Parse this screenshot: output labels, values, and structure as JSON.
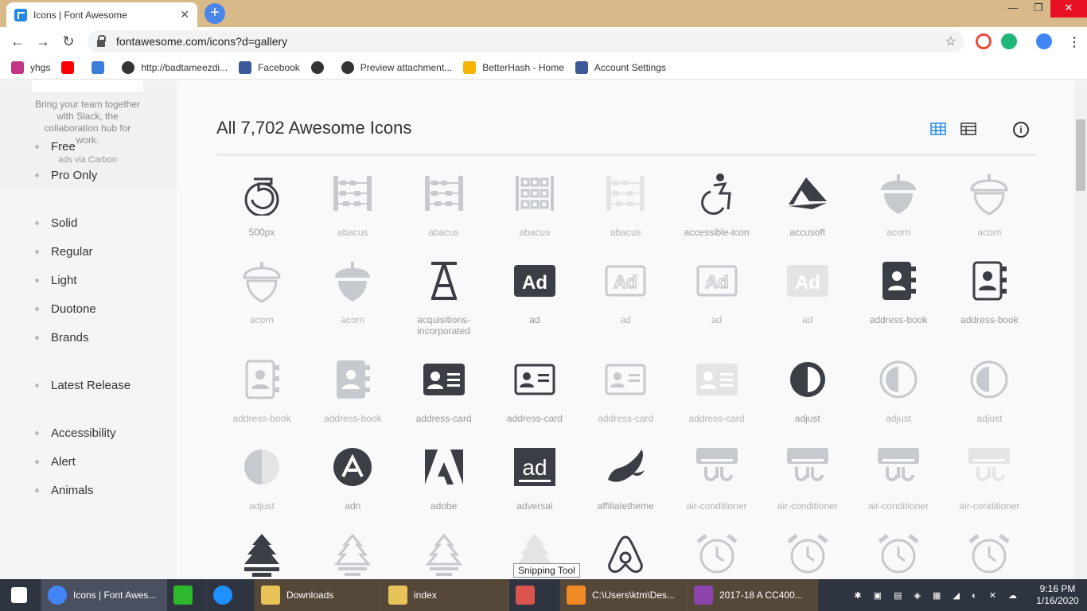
{
  "browser": {
    "tab_title": "Icons | Font Awesome",
    "tab_close": "✕",
    "new_tab": "+",
    "url": "fontawesome.com/icons?d=gallery",
    "window_minimize": "—",
    "window_maximize": "❐",
    "window_close": "✕",
    "back": "←",
    "forward": "→",
    "reload": "↻",
    "star": "☆"
  },
  "bookmarks": [
    {
      "label": "yhgs",
      "icon": "instagram-icon",
      "color": "#c13584"
    },
    {
      "label": "",
      "icon": "youtube-icon",
      "color": "#ff0000"
    },
    {
      "label": "",
      "icon": "bookmark-app-icon",
      "color": "#3b7dd8"
    },
    {
      "label": "http://badtameezdi...",
      "icon": "globe-icon",
      "color": "#333333"
    },
    {
      "label": "Facebook",
      "icon": "facebook-icon",
      "color": "#3b5998"
    },
    {
      "label": "",
      "icon": "globe-icon",
      "color": "#333333"
    },
    {
      "label": "Preview attachment...",
      "icon": "globe-icon",
      "color": "#333333"
    },
    {
      "label": "BetterHash - Home",
      "icon": "chrome-icon",
      "color": "#f4b400"
    },
    {
      "label": "Account Settings",
      "icon": "facebook-icon",
      "color": "#3b5998"
    }
  ],
  "sidebar": {
    "carbon_text": "Bring your team together with Slack, the collaboration hub for work.",
    "carbon_via": "ads via Carbon",
    "filters": [
      {
        "label": "Free"
      },
      {
        "label": "Pro Only"
      },
      {
        "label": "Solid"
      },
      {
        "label": "Regular"
      },
      {
        "label": "Light"
      },
      {
        "label": "Duotone"
      },
      {
        "label": "Brands"
      },
      {
        "label": "Latest Release"
      },
      {
        "label": "Accessibility"
      },
      {
        "label": "Alert"
      },
      {
        "label": "Animals"
      }
    ]
  },
  "main": {
    "heading": "All 7,702 Awesome Icons",
    "info": "i"
  },
  "icons": [
    {
      "name": "500px",
      "shape": "500px",
      "tone": "dark"
    },
    {
      "name": "abacus",
      "shape": "abacus",
      "tone": "light"
    },
    {
      "name": "abacus",
      "shape": "abacus",
      "tone": "light"
    },
    {
      "name": "abacus",
      "shape": "abacus-outline",
      "tone": "light"
    },
    {
      "name": "abacus",
      "shape": "abacus",
      "tone": "faint"
    },
    {
      "name": "accessible-icon",
      "shape": "wheelchair",
      "tone": "dark"
    },
    {
      "name": "accusoft",
      "shape": "accusoft",
      "tone": "dark"
    },
    {
      "name": "acorn",
      "shape": "acorn",
      "tone": "light"
    },
    {
      "name": "acorn",
      "shape": "acorn-outline",
      "tone": "light"
    },
    {
      "name": "acorn",
      "shape": "acorn-outline",
      "tone": "light"
    },
    {
      "name": "acorn",
      "shape": "acorn",
      "tone": "light"
    },
    {
      "name": "acquisitions-incorporated",
      "shape": "acq",
      "tone": "dark"
    },
    {
      "name": "ad",
      "shape": "ad",
      "tone": "dark"
    },
    {
      "name": "ad",
      "shape": "ad-outline",
      "tone": "light"
    },
    {
      "name": "ad",
      "shape": "ad-outline",
      "tone": "light"
    },
    {
      "name": "ad",
      "shape": "ad",
      "tone": "faint"
    },
    {
      "name": "address-book",
      "shape": "addrbook",
      "tone": "dark"
    },
    {
      "name": "address-book",
      "shape": "addrbook-outline",
      "tone": "dark"
    },
    {
      "name": "address-book",
      "shape": "addrbook-outline",
      "tone": "light"
    },
    {
      "name": "address-book",
      "shape": "addrbook",
      "tone": "light"
    },
    {
      "name": "address-card",
      "shape": "card",
      "tone": "dark"
    },
    {
      "name": "address-card",
      "shape": "card-outline",
      "tone": "dark"
    },
    {
      "name": "address-card",
      "shape": "card-outline",
      "tone": "light"
    },
    {
      "name": "address-card",
      "shape": "card",
      "tone": "faint"
    },
    {
      "name": "adjust",
      "shape": "adjust",
      "tone": "dark"
    },
    {
      "name": "adjust",
      "shape": "adjust-outline",
      "tone": "light"
    },
    {
      "name": "adjust",
      "shape": "adjust-outline",
      "tone": "light"
    },
    {
      "name": "adjust",
      "shape": "adjust-half",
      "tone": "light"
    },
    {
      "name": "adn",
      "shape": "adn",
      "tone": "dark"
    },
    {
      "name": "adobe",
      "shape": "adobe",
      "tone": "dark"
    },
    {
      "name": "adversal",
      "shape": "adversal",
      "tone": "dark"
    },
    {
      "name": "affiliatetheme",
      "shape": "affiliate",
      "tone": "dark"
    },
    {
      "name": "air-conditioner",
      "shape": "aircon",
      "tone": "light"
    },
    {
      "name": "air-conditioner",
      "shape": "aircon",
      "tone": "light"
    },
    {
      "name": "air-conditioner",
      "shape": "aircon",
      "tone": "light"
    },
    {
      "name": "air-conditioner",
      "shape": "aircon",
      "tone": "faint"
    },
    {
      "name": "",
      "shape": "tree",
      "tone": "dark"
    },
    {
      "name": "",
      "shape": "tree-outline",
      "tone": "light"
    },
    {
      "name": "",
      "shape": "tree-outline",
      "tone": "light"
    },
    {
      "name": "",
      "shape": "tree",
      "tone": "faint"
    },
    {
      "name": "",
      "shape": "airbnb",
      "tone": "dark"
    },
    {
      "name": "",
      "shape": "clock",
      "tone": "light"
    },
    {
      "name": "",
      "shape": "clock",
      "tone": "light"
    },
    {
      "name": "",
      "shape": "clock",
      "tone": "light"
    },
    {
      "name": "",
      "shape": "clock",
      "tone": "light"
    }
  ],
  "taskbar": {
    "items": [
      {
        "label": "",
        "icon": "windows-start-icon"
      },
      {
        "label": "Icons | Font Awes...",
        "icon": "chrome-icon"
      },
      {
        "label": "",
        "icon": "store-icon"
      },
      {
        "label": "",
        "icon": "ie-icon"
      },
      {
        "label": "Downloads",
        "icon": "folder-icon"
      },
      {
        "label": "index",
        "icon": "folder-icon"
      },
      {
        "label": "",
        "icon": "snipping-tool-icon"
      },
      {
        "label": "C:\\Users\\ktm\\Des...",
        "icon": "sublime-icon"
      },
      {
        "label": "2017-18 A CC400...",
        "icon": "winrar-icon"
      }
    ],
    "tooltip": "Snipping Tool",
    "time": "9:16 PM",
    "date": "1/16/2020"
  },
  "colors": {
    "dark": "#3b3f45",
    "light": "#c6c9cd",
    "faint": "#e2e4e6",
    "label_dark": "#999999",
    "label_light": "#b0b3b7",
    "accent": "#228ae6"
  }
}
